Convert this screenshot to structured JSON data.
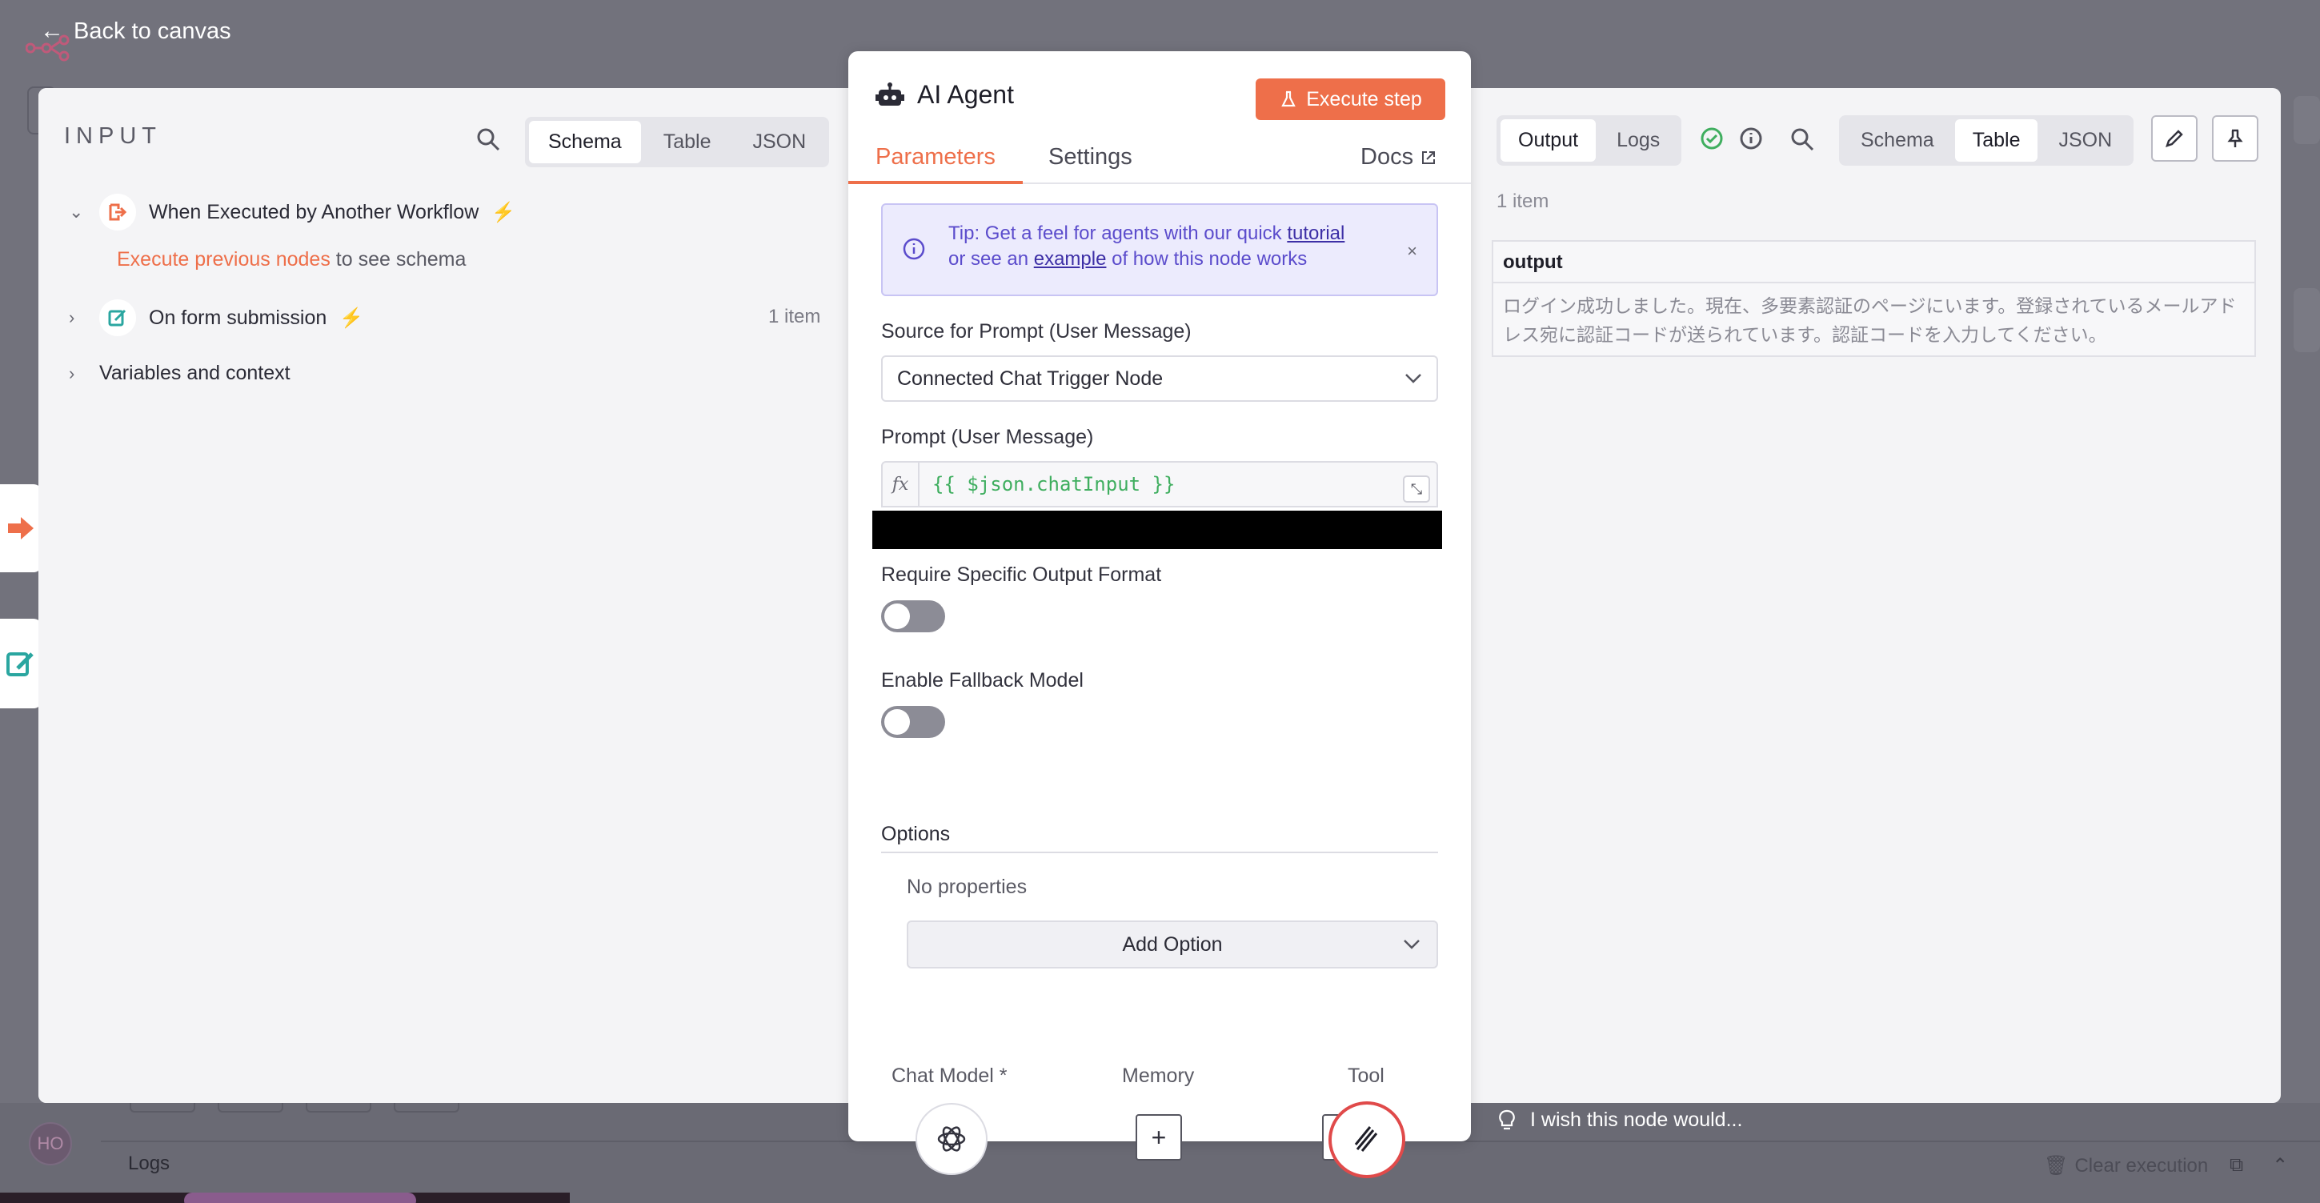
{
  "header": {
    "back_label": "Back to canvas"
  },
  "input": {
    "title": "INPUT",
    "view_tabs": [
      "Schema",
      "Table",
      "JSON"
    ],
    "active_view": "Schema",
    "nodes": [
      {
        "label": "When Executed by Another Workflow",
        "expanded": true
      },
      {
        "label": "On form submission",
        "count": "1 item",
        "expanded": false
      }
    ],
    "execute_link": "Execute previous nodes",
    "execute_suffix": "to see schema",
    "variables_label": "Variables and context"
  },
  "node": {
    "title": "AI Agent",
    "execute_label": "Execute step",
    "tabs": {
      "parameters": "Parameters",
      "settings": "Settings",
      "docs": "Docs"
    },
    "tip": {
      "text_1": "Tip: Get a feel for agents with our quick ",
      "link_1": "tutorial",
      "text_2": "or see an ",
      "link_2": "example",
      "text_3": " of how this node works"
    },
    "source_label": "Source for Prompt (User Message)",
    "source_value": "Connected Chat Trigger Node",
    "prompt_label": "Prompt (User Message)",
    "prompt_fx": "fx",
    "prompt_value": "{{ $json.chatInput }}",
    "require_label": "Require Specific Output Format",
    "fallback_label": "Enable Fallback Model",
    "options_label": "Options",
    "no_properties": "No properties",
    "add_option": "Add Option",
    "sub_nodes": {
      "chat_model": "Chat Model *",
      "memory": "Memory",
      "tool": "Tool"
    }
  },
  "output": {
    "tabs": [
      "Output",
      "Logs"
    ],
    "active_tab": "Output",
    "view_tabs": [
      "Schema",
      "Table",
      "JSON"
    ],
    "active_view": "Table",
    "count": "1 item",
    "column": "output",
    "value": "ログイン成功しました。現在、多要素認証のページにいます。登録されているメールアドレス宛に認証コードが送られています。認証コードを入力してください。",
    "wish": "I wish this node would..."
  },
  "footer": {
    "logs": "Logs",
    "clear": "Clear execution",
    "avatar": "HO"
  },
  "colors": {
    "accent": "#ee6f4a",
    "success": "#3fae5f",
    "tip_text": "#5b4ccc"
  }
}
